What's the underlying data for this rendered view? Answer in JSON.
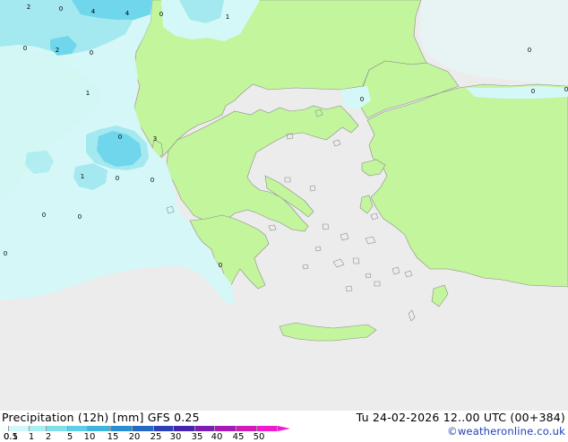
{
  "footer": {
    "title": "Precipitation (12h) [mm] GFS 0.25",
    "run_info": "Tu 24-02-2026 12..00 UTC (00+384)",
    "credit": "©weatheronline.co.uk"
  },
  "legend": {
    "ticks": [
      "0.1",
      "0.5",
      "1",
      "2",
      "5",
      "10",
      "15",
      "20",
      "25",
      "30",
      "35",
      "40",
      "45",
      "50"
    ],
    "colors": [
      "#f5fefe",
      "#d0f8f8",
      "#a8eef2",
      "#7fe0ec",
      "#5ccfe6",
      "#3fb4dc",
      "#2a8fd2",
      "#2568c6",
      "#2a3fb8",
      "#4424b0",
      "#7a1fb4",
      "#a81ab8",
      "#d21ab8",
      "#f01ad0"
    ]
  },
  "map_labels": [
    "2",
    "0",
    "4",
    "4",
    "0",
    "1",
    "2",
    "0",
    "0",
    "1",
    "0",
    "3",
    "1",
    "0",
    "0",
    "0",
    "0",
    "0",
    "0",
    "0",
    "0",
    "0",
    "0"
  ],
  "colors": {
    "sea": "#ececec",
    "land": "#c3f59c",
    "precip_light": "#d4f8f8",
    "precip_medium": "#a4e9ef",
    "precip_strong": "#6fd6ec",
    "coast": "#8c8c8c"
  }
}
